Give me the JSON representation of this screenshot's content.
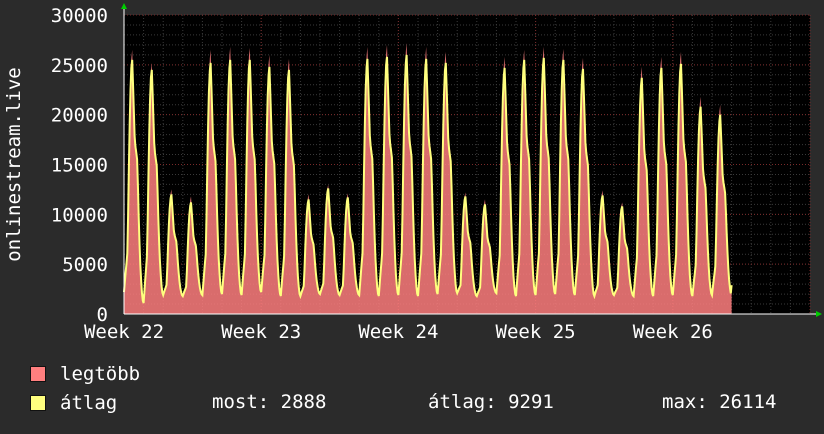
{
  "chart_data": {
    "type": "area",
    "ylabel": "onlinestream.live",
    "ylim": [
      0,
      30000
    ],
    "yticks": [
      0,
      5000,
      10000,
      15000,
      20000,
      25000,
      30000
    ],
    "ytick_labels": [
      "0",
      "5000",
      "10000",
      "15000",
      "20000",
      "25000",
      "30000"
    ],
    "xlim": [
      0,
      35
    ],
    "xticks": [
      0,
      7,
      14,
      21,
      28,
      35
    ],
    "xtick_labels": [
      "Week 22",
      "Week 23",
      "Week 24",
      "Week 25",
      "Week 26"
    ],
    "grid": true,
    "series": [
      {
        "name": "legtöbb",
        "color": "#ff7f7f",
        "daily_peaks": [
          26500,
          25200,
          12500,
          11800,
          26500,
          26800,
          26700,
          26000,
          25600,
          12000,
          13000,
          12100,
          26800,
          27000,
          27200,
          26800,
          26300,
          12200,
          11500,
          25800,
          26500,
          26800,
          26600,
          25700,
          12400,
          11200,
          24800,
          25800,
          26300,
          21800,
          21000
        ],
        "daily_troughs": [
          2500,
          1300,
          2200,
          2000,
          2100,
          2200,
          2100,
          2400,
          2000,
          2000,
          2200,
          2100,
          2100,
          2000,
          2100,
          2000,
          2200,
          2300,
          2000,
          2300,
          2000,
          2100,
          2200,
          2100,
          2000,
          2100,
          2000,
          2000,
          2100,
          2000,
          2100
        ]
      },
      {
        "name": "átlag",
        "color": "#ffff7f",
        "daily_peaks": [
          25500,
          24500,
          12000,
          11200,
          25200,
          25500,
          25500,
          24800,
          24500,
          11500,
          12600,
          11700,
          25600,
          25800,
          26000,
          25600,
          25200,
          11800,
          11000,
          24700,
          25500,
          25700,
          25500,
          24600,
          11900,
          10800,
          23700,
          24700,
          25100,
          20800,
          20000
        ],
        "daily_troughs": [
          2200,
          1100,
          1900,
          1800,
          1900,
          2000,
          1900,
          2200,
          1800,
          1800,
          2000,
          1900,
          1900,
          1800,
          1900,
          1800,
          2000,
          2100,
          1800,
          2100,
          1800,
          1900,
          2000,
          1900,
          1800,
          1900,
          1800,
          1800,
          1900,
          1800,
          1900
        ]
      }
    ],
    "end_value": 2888
  },
  "legend": {
    "max_label": "legtöbb",
    "avg_label": "átlag",
    "max_color": "#ff7f7f",
    "avg_color": "#ffff7f"
  },
  "stats": {
    "now": "most: 2888",
    "average": "átlag: 9291",
    "max": "max: 26114"
  }
}
